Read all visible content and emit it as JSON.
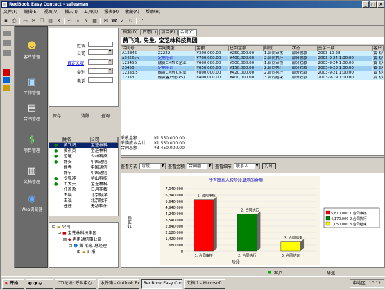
{
  "app": {
    "title": "RedBook Easy Contact - salesman"
  },
  "menu": [
    "文件(F)",
    "编辑(E)",
    "视图(V)",
    "插入(I)",
    "工具(T)",
    "报表(R)",
    "收藏(A)",
    "帮助(H)"
  ],
  "toolbar_icons": [
    "save-icon",
    "print-icon",
    "new-icon",
    "cut-icon",
    "copy-icon",
    "paste-icon",
    "delete-icon",
    "undo-icon",
    "find-icon",
    "filter-icon",
    "report-icon",
    "mail-icon",
    "phone-icon",
    "task-icon",
    "refresh-icon",
    "help-icon"
  ],
  "nav": [
    {
      "label": "客户管理",
      "icon": "contacts-icon"
    },
    {
      "label": "工作管理",
      "icon": "work-icon"
    },
    {
      "label": "合同管理",
      "icon": "contract-icon"
    },
    {
      "label": "项目管理",
      "icon": "project-icon"
    },
    {
      "label": "文档管理",
      "icon": "document-icon"
    },
    {
      "label": "Web浏览器",
      "icon": "web-icon"
    }
  ],
  "form": {
    "name_label": "姓名",
    "company_label": "公司",
    "custom_label": "自定义域",
    "category_label": "类别",
    "phone_label": "电话"
  },
  "form_buttons": {
    "save": "保存",
    "clear": "清除",
    "query": "查询"
  },
  "contact_list": {
    "headers": [
      "",
      "姓名",
      "公司"
    ],
    "rows": [
      {
        "name": "黄飞鸿",
        "company": "宝芝林科"
      },
      {
        "name": "黄祺英",
        "company": "宝芝林科"
      },
      {
        "name": "范曜",
        "company": "少林科技"
      },
      {
        "name": "静安",
        "company": "中国通信"
      },
      {
        "name": "静春",
        "company": "中国通信"
      },
      {
        "name": "静宁",
        "company": "中国通信"
      },
      {
        "name": "令狐冲",
        "company": "华山科技"
      },
      {
        "name": "土大夫",
        "company": "宝芝林科"
      },
      {
        "name": "任盈盈",
        "company": "日月神教"
      },
      {
        "name": "王福",
        "company": "北京融洋"
      },
      {
        "name": "王福",
        "company": "北京融洋"
      },
      {
        "name": "任莊",
        "company": "无敌软件"
      }
    ]
  },
  "tree": {
    "root": "公司",
    "n1": "宝芝林科技集团",
    "n2": "再用通信事业部",
    "n3": "黄飞鸿, 总经理",
    "n4": "汇报"
  },
  "tabs": [
    "档案(D)",
    "日志(L)",
    "项目(P)",
    "合同(C)"
  ],
  "active_tab": "合同(C)",
  "contact_header": "黄飞鸿, 先生, 宝芝林科技集团",
  "contract_grid": {
    "headers": [
      "合同号",
      "合同类型",
      "金额",
      "已到金额",
      "阶段",
      "状态",
      "签字日期",
      "客户"
    ],
    "rows": [
      {
        "no": "A12345",
        "type": "22222",
        "amount": "¥300,000.00",
        "received": "¥250,000.00",
        "stage": "1.合同审核",
        "status": "部分收款",
        "date": "2003-10-28",
        "client": "黄飞鸿"
      },
      {
        "no": "a3456yh",
        "type": "定制培训",
        "amount": "¥700,000.00",
        "received": "¥400,000.00",
        "stage": "2.合同执行",
        "status": "部分收款",
        "date": "2003-9-24 1:00:00",
        "client": "黄飞鸿"
      },
      {
        "no": "123456",
        "type": "融资CMM C企业",
        "amount": "¥600,000.00",
        "received": "¥500,000.00",
        "stage": "1.合同审核",
        "status": "部分收款",
        "date": "2003-9-24 1:00:00",
        "client": "黄飞鸿"
      },
      {
        "no": "23456",
        "type": "定制培训",
        "amount": "¥650,000.00",
        "received": "¥150,000.00",
        "stage": "2.合同执行",
        "status": "部分收款",
        "date": "2003-9-23 1:00:00",
        "client": "黄飞鸿"
      },
      {
        "no": "123ab/5",
        "type": "融资CMM C企业",
        "amount": "¥800,000.00",
        "received": "¥420,000.00",
        "stage": "2.合同执行",
        "status": "部分收款",
        "date": "2003-9-21 1:00:00",
        "client": "黄飞鸿"
      },
      {
        "no": "123ab",
        "type": "融资客户进(PS)",
        "amount": "¥400,000.00",
        "received": "¥400,000.00",
        "stage": "3.合同结束",
        "status": "部分收款",
        "date": "2003-9-19 1:00:00",
        "client": "黄飞鸿"
      }
    ]
  },
  "totals": [
    {
      "label": "采收金额",
      "value": "¥1,550,000.00"
    },
    {
      "label": "采购成本合计",
      "value": "¥1,550,000.00"
    },
    {
      "label": "合同总额",
      "value": "¥3,450,000.00"
    }
  ],
  "chart_controls": {
    "view_label": "查看方式",
    "view_value": "阶段",
    "amount_label": "查看金额",
    "amount_value": "合同额",
    "detail_label": "查看细节",
    "detail_value": "联系人",
    "print": "打印"
  },
  "chart_data": {
    "type": "bar",
    "title": "所有联系人按阶段显示的金额",
    "xlabel": "阶段",
    "ylabel": "合同额",
    "categories": [
      "1. 合同审核",
      "2. 合同执行",
      "3. 合同结束"
    ],
    "values": [
      5810000,
      4170000,
      1050000
    ],
    "ylim": [
      0,
      7040000
    ],
    "yticks": [
      "7,040,000",
      "6,340,000",
      "5,640,000",
      "4,940,000",
      "4,240,000",
      "3,540,000",
      "2,840,000",
      "2,120,000",
      "1,420,000",
      "680,000",
      "0"
    ],
    "colors": [
      "#ff0000",
      "#008000",
      "#ffff00"
    ],
    "legend": [
      "5,810,000 1.合同审核",
      "4,170,000 2.合同执行",
      "1,050,000 3.合同结束"
    ],
    "legend_position": "right"
  },
  "status": {
    "left": "客户",
    "right": "华北"
  },
  "taskbar": {
    "start": "开始",
    "items": [
      "CTI论坛: 呼叫中心...",
      "收件箱 - Outlook Ex...",
      "RedBook Easy Contac...",
      "文档 1 - Microsoft..."
    ],
    "active": 2,
    "tray_region": "中地区",
    "clock": "17:12"
  }
}
